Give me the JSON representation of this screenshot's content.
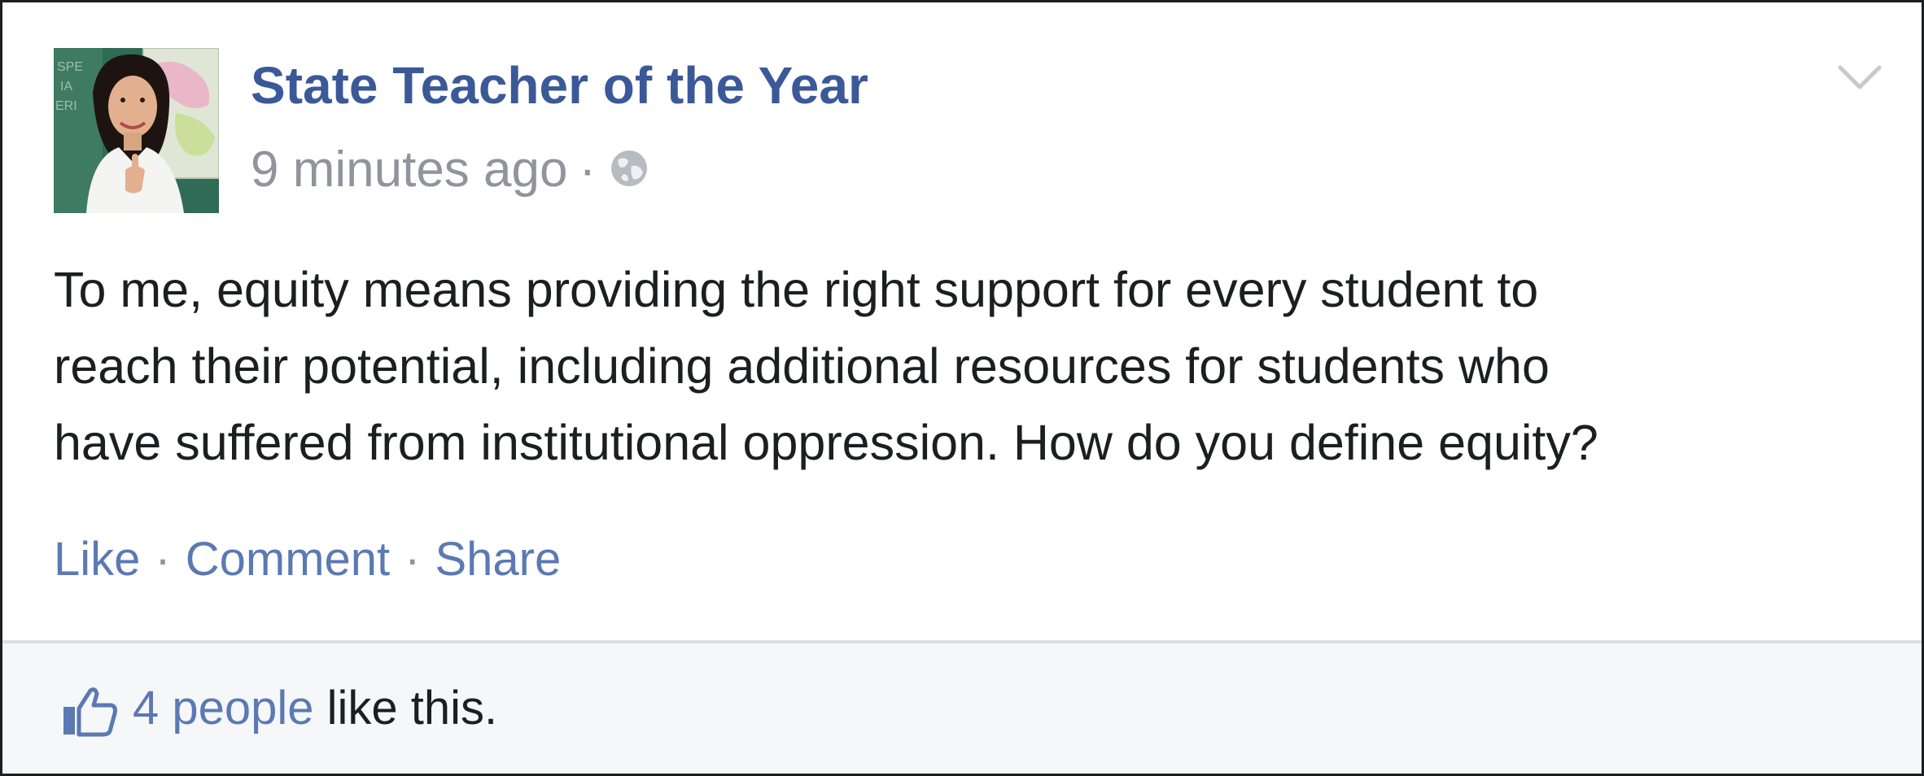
{
  "post": {
    "author": "State Teacher of the Year",
    "timestamp": "9 minutes ago",
    "separator": "·",
    "privacy_icon": "globe-icon",
    "text_lines": [
      "To me, equity means providing the right support for every student to",
      "reach their potential, including additional resources for students who",
      "have suffered from institutional oppression. How do you define equity?"
    ]
  },
  "actions": {
    "like": "Like",
    "comment": "Comment",
    "share": "Share",
    "separator": "·"
  },
  "likes": {
    "icon": "thumbs-up-icon",
    "people": "4 people",
    "suffix": " like this."
  },
  "colors": {
    "link": "#3b5998",
    "action": "#5b79b3",
    "muted": "#90949c",
    "text": "#1c1e21",
    "footer_bg": "#f6f7f9"
  }
}
